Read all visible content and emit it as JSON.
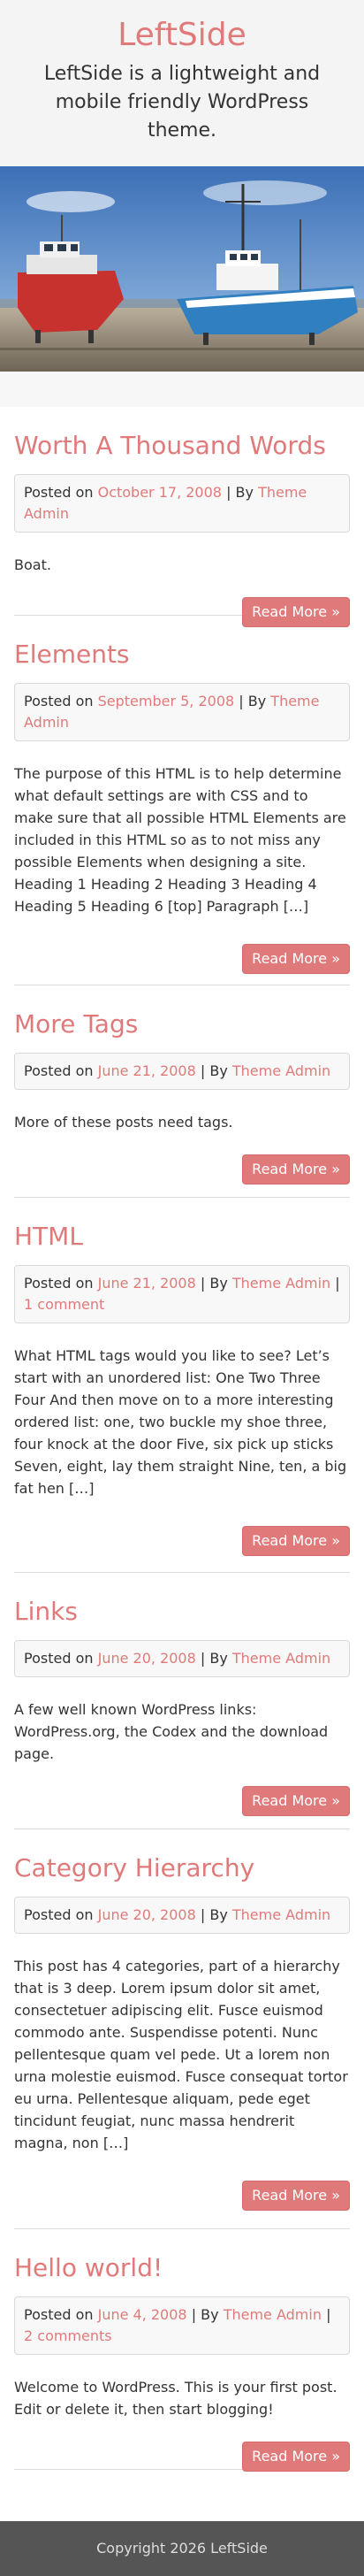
{
  "site": {
    "title": "LeftSide",
    "description": "LeftSide is a lightweight and mobile friendly WordPress theme."
  },
  "hero": {
    "alt": "Boats on dry dock"
  },
  "read_more_label": "Read More »",
  "posts": [
    {
      "title": "Worth A Thousand Words",
      "posted_on": "Posted on",
      "date": "October 17, 2008",
      "by": "| By",
      "author": "Theme Admin",
      "comments": "",
      "excerpt": "Boat."
    },
    {
      "title": "Elements",
      "posted_on": "Posted on",
      "date": "September 5, 2008",
      "by": "| By",
      "author": "Theme Admin",
      "comments": "",
      "excerpt": "The purpose of this HTML is to help determine what default settings are with CSS and to make sure that all possible HTML Elements are included in this HTML so as to not miss any possible Elements when designing a site. Heading 1 Heading 2 Heading 3 Heading 4 Heading 5 Heading 6 [top] Paragraph […]"
    },
    {
      "title": "More Tags",
      "posted_on": "Posted on",
      "date": "June 21, 2008",
      "by": "| By",
      "author": "Theme Admin",
      "comments": "",
      "excerpt": "More of these posts need tags."
    },
    {
      "title": "HTML",
      "posted_on": "Posted on",
      "date": "June 21, 2008",
      "by": "| By",
      "author": "Theme Admin",
      "comments_sep": "|",
      "comments": "1 comment",
      "excerpt": "What HTML tags would you like to see? Let’s start with an unordered list: One Two Three Four And then move on to a more interesting ordered list: one, two buckle my shoe three, four knock at the door Five, six pick up sticks Seven, eight, lay them straight Nine, ten, a big fat hen […]"
    },
    {
      "title": "Links",
      "posted_on": "Posted on",
      "date": "June 20, 2008",
      "by": "| By",
      "author": "Theme Admin",
      "comments": "",
      "excerpt": "A few well known WordPress links: WordPress.org, the Codex and the download page."
    },
    {
      "title": "Category Hierarchy",
      "posted_on": "Posted on",
      "date": "June 20, 2008",
      "by": "| By",
      "author": "Theme Admin",
      "comments": "",
      "excerpt": "This post has 4 categories, part of a hierarchy that is 3 deep. Lorem ipsum dolor sit amet, consectetuer adipiscing elit. Fusce euismod commodo ante. Suspendisse potenti. Nunc pellentesque quam vel pede. Ut a lorem non urna molestie euismod. Fusce consequat tortor eu urna. Pellentesque aliquam, pede eget tincidunt feugiat, nunc massa hendrerit magna, non […]"
    },
    {
      "title": "Hello world!",
      "posted_on": "Posted on",
      "date": "June 4, 2008",
      "by": "| By",
      "author": "Theme Admin",
      "comments_sep": "|",
      "comments": "2 comments",
      "excerpt": "Welcome to WordPress. This is your first post. Edit or delete it, then start blogging!"
    }
  ],
  "footer": {
    "copyright": "Copyright 2026 LeftSide"
  },
  "colors": {
    "accent": "#e07a7a",
    "footer_bg": "#555555",
    "header_bg": "#f4f4f4"
  }
}
